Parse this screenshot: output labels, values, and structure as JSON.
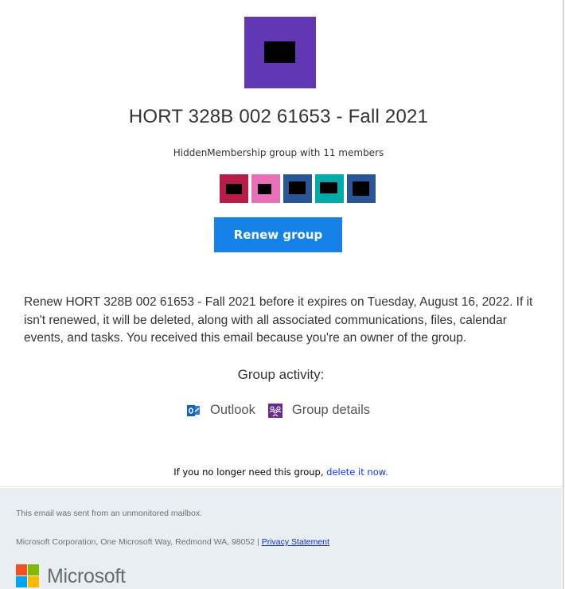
{
  "group": {
    "title": "HORT 328B 002 61653 - Fall 2021",
    "subtitle": "HiddenMembership group with 11 members",
    "logo_color": "#6237b5",
    "member_colors": [
      "#b81c48",
      "#e86fb8",
      "#2a5596",
      "#00aba9",
      "#2a5596"
    ]
  },
  "actions": {
    "renew_label": "Renew group",
    "renew_color": "#1681e8"
  },
  "message": {
    "body": "Renew HORT 328B 002 61653 - Fall 2021 before it expires on Tuesday, August 16, 2022. If it isn't renewed, it will be deleted, along with all associated communications, files, calendar events, and tasks. You received this email because you're an owner of the group."
  },
  "activity": {
    "label": "Group activity:",
    "links": [
      {
        "icon": "outlook-icon",
        "label": "Outlook"
      },
      {
        "icon": "group-details-icon",
        "label": "Group details"
      }
    ]
  },
  "delete": {
    "prefix": "If you no longer need this group, ",
    "link": "delete it now."
  },
  "footer": {
    "unmonitored": "This email was sent from an unmonitored mailbox.",
    "address": "Microsoft Corporation, One Microsoft Way, Redmond WA, 98052 | ",
    "privacy_link": "Privacy Statement",
    "brand": "Microsoft"
  }
}
